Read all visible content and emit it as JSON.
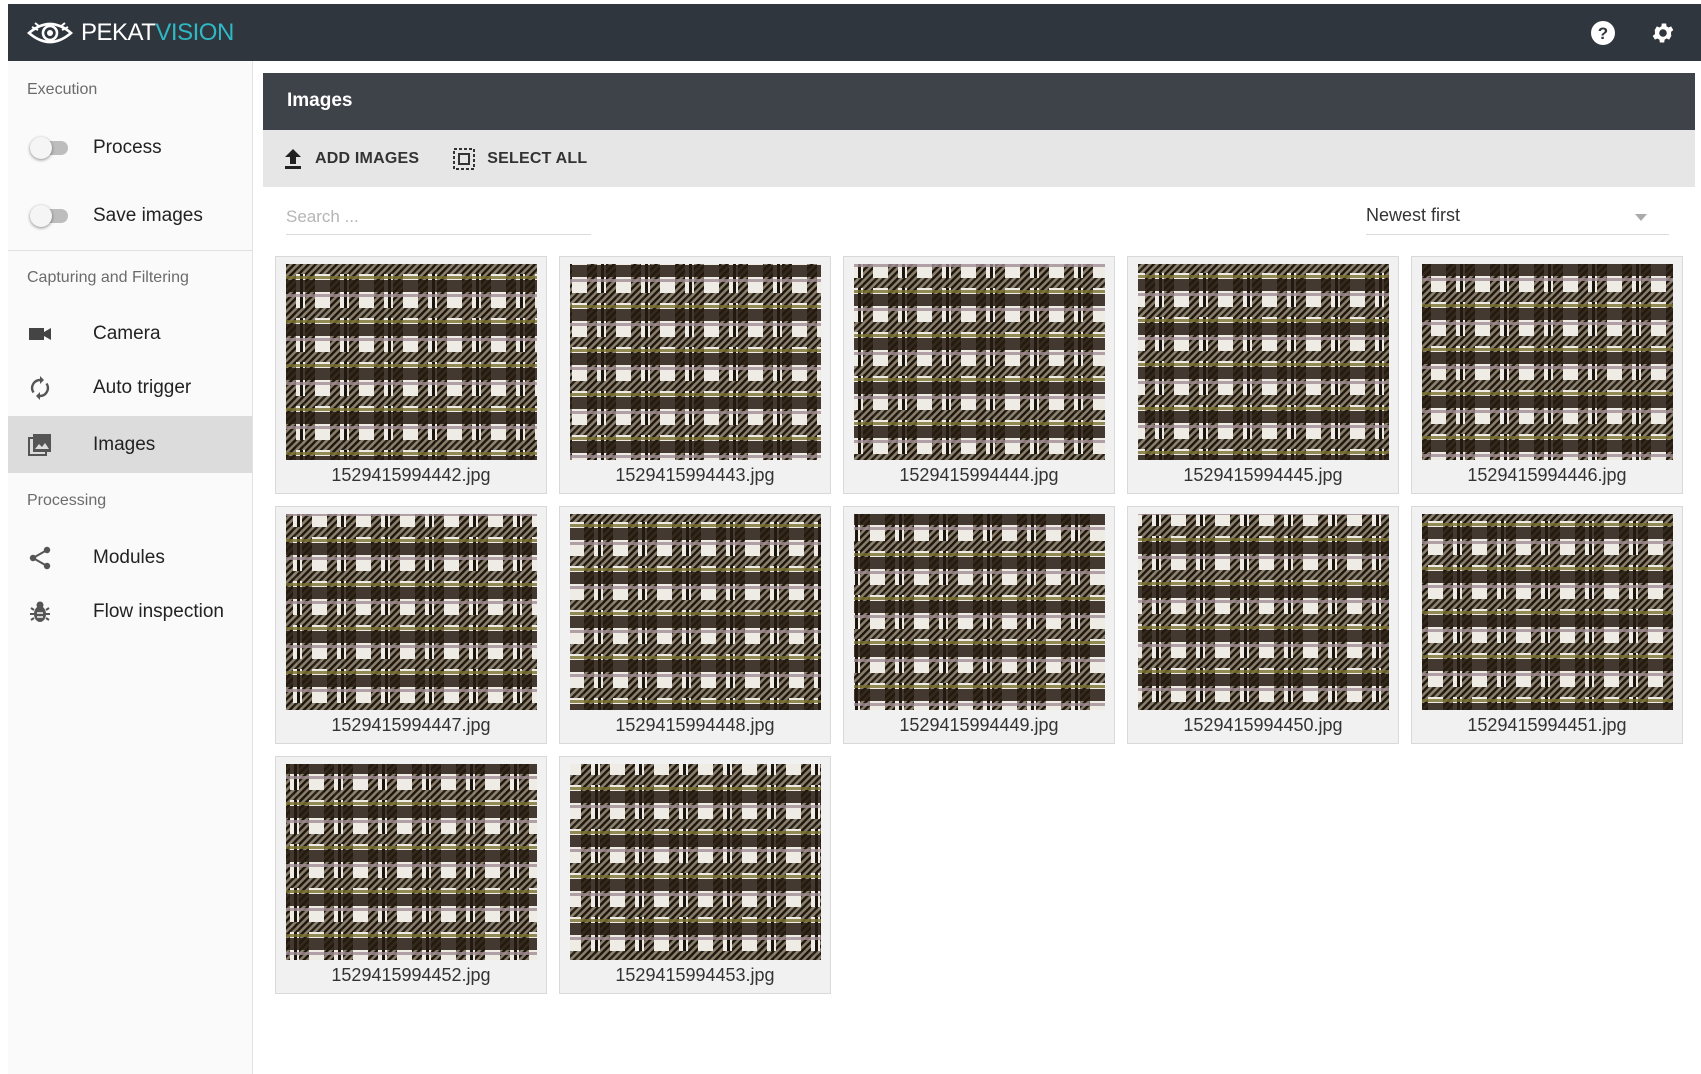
{
  "app": {
    "brand_part1": "PEKAT",
    "brand_part2": "VISION",
    "accent_color": "#2eb8c4",
    "topbar_color": "#30363d",
    "help_icon": "help-circle-icon",
    "settings_icon": "gear-icon"
  },
  "sidebar": {
    "sections": {
      "execution": "Execution",
      "capturing": "Capturing and Filtering",
      "processing": "Processing"
    },
    "process_label": "Process",
    "process_on": false,
    "save_images_label": "Save images",
    "save_images_on": false,
    "camera_label": "Camera",
    "auto_trigger_label": "Auto trigger",
    "images_label": "Images",
    "modules_label": "Modules",
    "flow_inspection_label": "Flow inspection",
    "active_item": "Images"
  },
  "panel": {
    "title": "Images",
    "add_images_label": "ADD IMAGES",
    "select_all_label": "SELECT ALL",
    "search_placeholder": "Search ...",
    "search_value": "",
    "sort_value": "Newest first"
  },
  "images": [
    {
      "name": "1529415994442.jpg"
    },
    {
      "name": "1529415994443.jpg"
    },
    {
      "name": "1529415994444.jpg"
    },
    {
      "name": "1529415994445.jpg"
    },
    {
      "name": "1529415994446.jpg"
    },
    {
      "name": "1529415994447.jpg"
    },
    {
      "name": "1529415994448.jpg"
    },
    {
      "name": "1529415994449.jpg"
    },
    {
      "name": "1529415994450.jpg"
    },
    {
      "name": "1529415994451.jpg"
    },
    {
      "name": "1529415994452.jpg"
    },
    {
      "name": "1529415994453.jpg"
    }
  ]
}
